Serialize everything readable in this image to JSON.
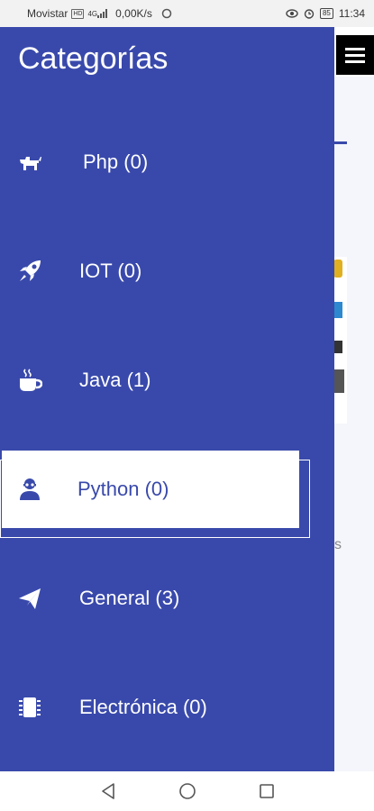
{
  "status_bar": {
    "carrier": "Movistar",
    "network_badge": "HD",
    "signal_label": "4G",
    "speed": "0,00K/s",
    "time": "11:34",
    "battery": "85"
  },
  "drawer": {
    "title": "Categorías",
    "colors": {
      "background": "#3949ab",
      "selected_bg": "#ffffff",
      "text": "#ffffff"
    },
    "items": [
      {
        "label": "Php (0)",
        "icon": "dog-icon",
        "selected": false
      },
      {
        "label": "IOT (0)",
        "icon": "rocket-icon",
        "selected": false
      },
      {
        "label": "Java (1)",
        "icon": "coffee-icon",
        "selected": false
      },
      {
        "label": "Python (0)",
        "icon": "user-secret-icon",
        "selected": true
      },
      {
        "label": "General (3)",
        "icon": "paper-plane-icon",
        "selected": false
      },
      {
        "label": "Electrónica (0)",
        "icon": "chip-icon",
        "selected": false
      }
    ]
  },
  "background_app": {
    "partial_text": "s"
  },
  "nav_bar": {
    "back": "back-icon",
    "home": "home-icon",
    "recents": "recents-icon"
  }
}
